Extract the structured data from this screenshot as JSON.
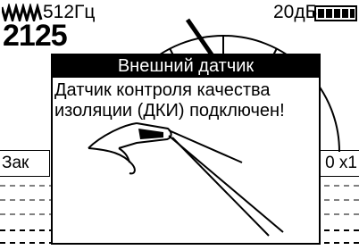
{
  "status_bar": {
    "frequency": "512Гц",
    "gain": "20дБ",
    "wave_icon": "waveform-icon",
    "battery_icon": "battery-icon"
  },
  "main": {
    "big_value": "2125",
    "mode_label": "Зак",
    "zoom_label": "0 x1",
    "signal_value": "29"
  },
  "dialog": {
    "title": "Внешний датчик",
    "message": "Датчик контроля качества\nизоляции (ДКИ) подключен!",
    "illustration": "insulation-sensor-clamp-icon"
  },
  "colors": {
    "foreground": "#000000",
    "background": "#ffffff"
  }
}
